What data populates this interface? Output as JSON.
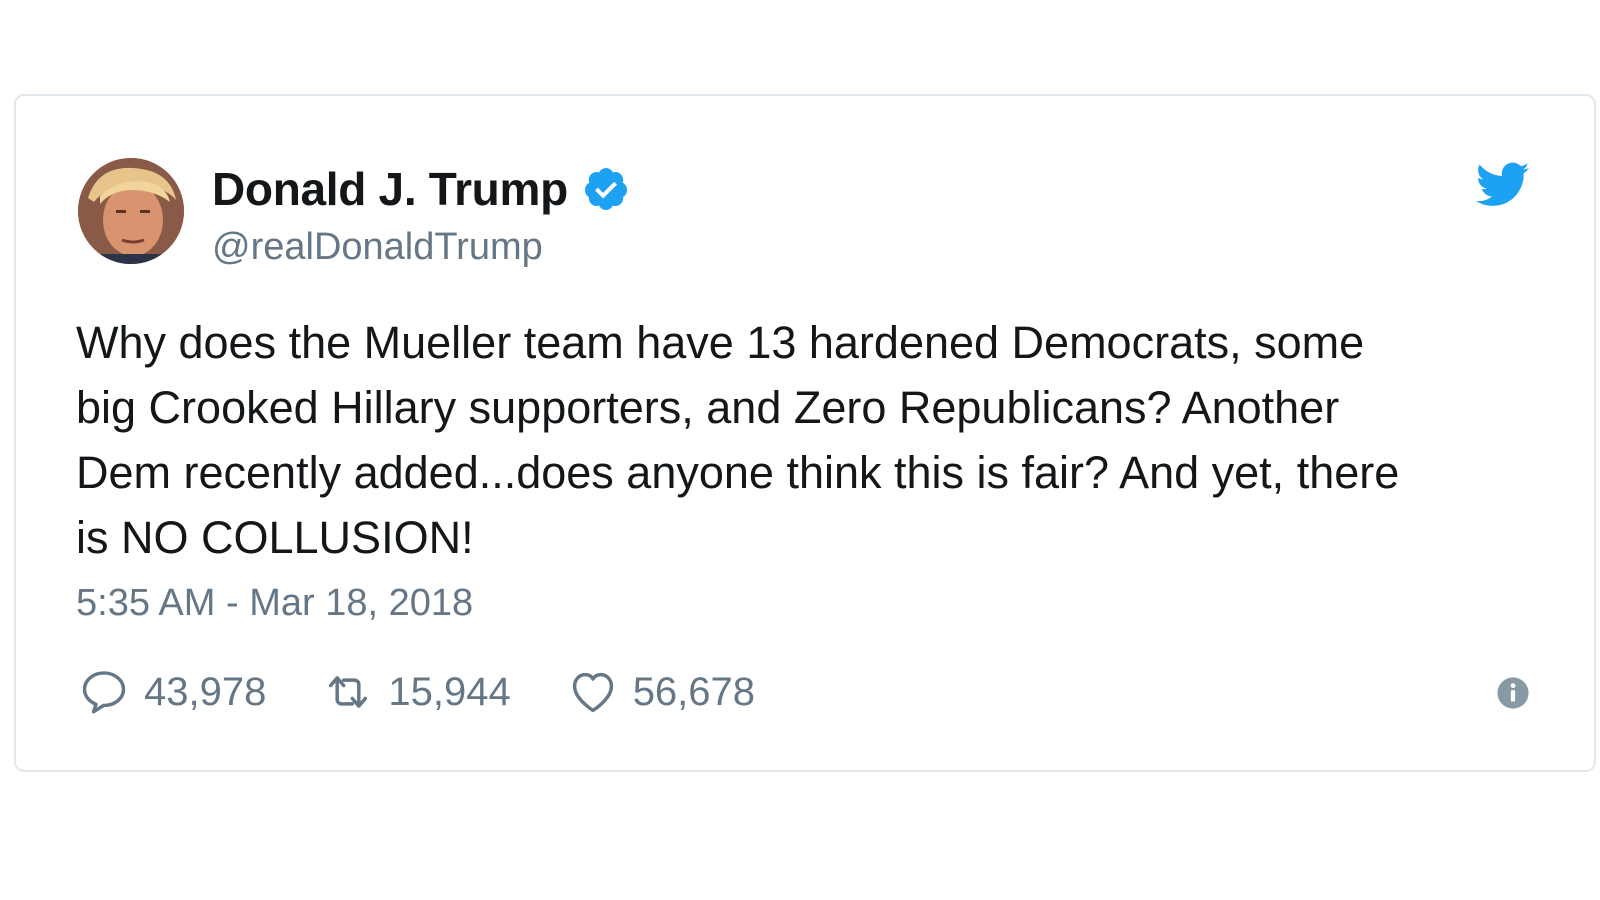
{
  "tweet": {
    "display_name": "Donald J. Trump",
    "handle": "@realDonaldTrump",
    "verified": true,
    "text": "Why does the Mueller team have 13 hardened Democrats, some\nbig Crooked Hillary supporters, and Zero Republicans? Another\nDem recently added...does anyone think this is fair? And yet, there\nis NO COLLUSION!",
    "timestamp": "5:35 AM - Mar 18, 2018"
  },
  "actions": {
    "replies": "43,978",
    "retweets": "15,944",
    "likes": "56,678"
  },
  "icons": {
    "reply": "reply-icon",
    "retweet": "retweet-icon",
    "like": "heart-icon",
    "info": "info-icon",
    "brand": "twitter-bird-icon",
    "verified": "verified-badge-icon"
  },
  "colors": {
    "brand_blue": "#1da1f2",
    "text_primary": "#14171a",
    "text_secondary": "#657786",
    "border": "#e1e8ed"
  }
}
